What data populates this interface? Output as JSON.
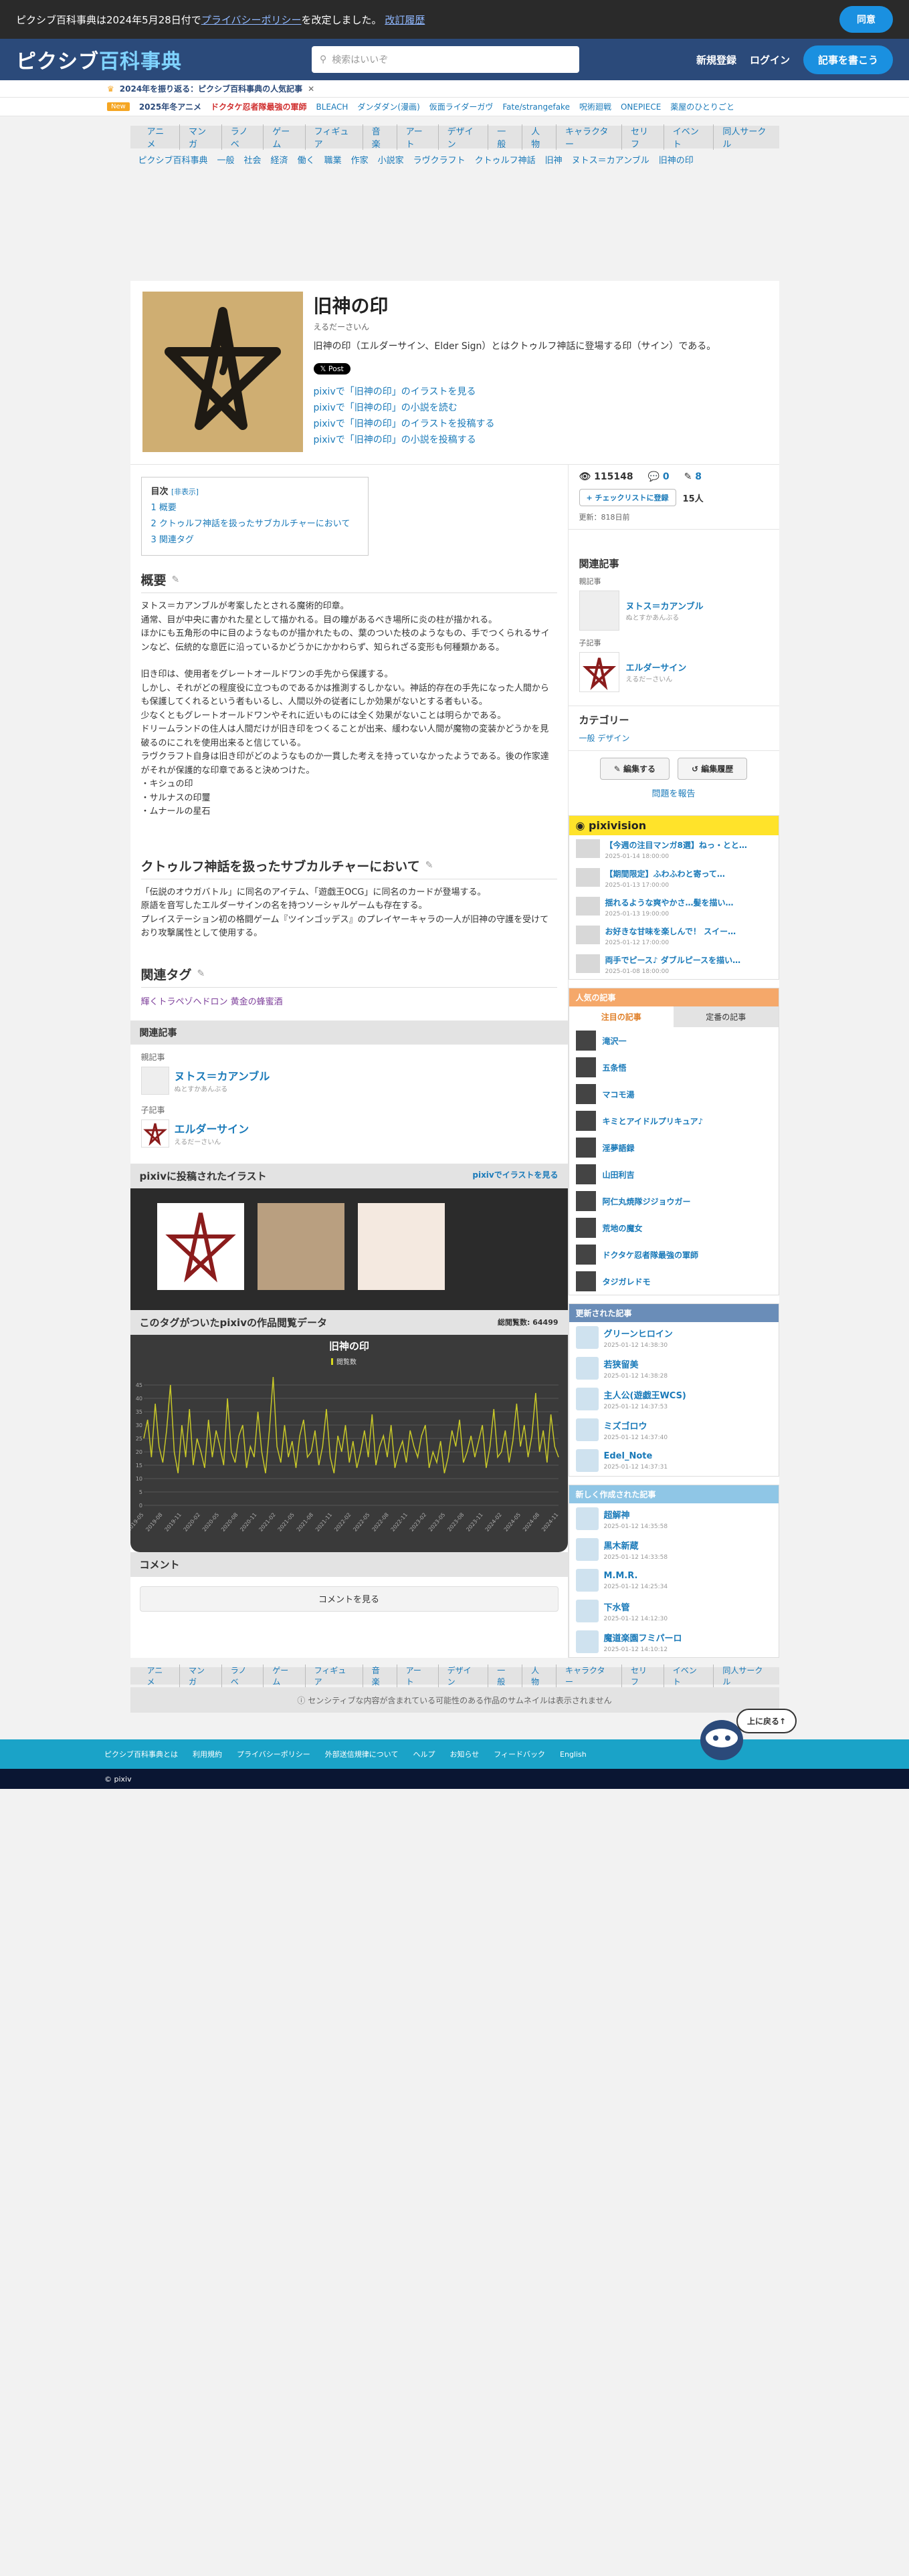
{
  "cookie": {
    "text1": "ピクシブ百科事典は2024年5月28日付で",
    "link": "プライバシーポリシー",
    "text2": "を改定しました。",
    "history": "改訂履歴",
    "agree": "同意"
  },
  "header": {
    "logo1": "ピクシブ",
    "logo2": "百科事典",
    "search_placeholder": "検索はいいぞ",
    "signup": "新規登録",
    "login": "ログイン",
    "edit": "記事を書こう"
  },
  "announce": "2024年を振り返る：ピクシブ百科事典の人気記事",
  "trend": {
    "badge": "New",
    "items": [
      "2025年冬アニメ",
      "ドクタケ忍者隊最強の軍師",
      "BLEACH",
      "ダンダダン(漫画)",
      "仮面ライダーガヴ",
      "Fate/strangefake",
      "呪術廻戦",
      "ONEPIECE",
      "薬屋のひとりごと"
    ]
  },
  "categories": [
    "アニメ",
    "マンガ",
    "ラノベ",
    "ゲーム",
    "フィギュア",
    "音楽",
    "アート",
    "デザイン",
    "一般",
    "人物",
    "キャラクター",
    "セリフ",
    "イベント",
    "同人サークル"
  ],
  "breadcrumb": [
    "ピクシブ百科事典",
    "一般",
    "社会",
    "経済",
    "働く",
    "職業",
    "作家",
    "小説家",
    "ラヴクラフト",
    "クトゥルフ神話",
    "旧神",
    "ヌトス＝カアンブル",
    "旧神の印"
  ],
  "article": {
    "title": "旧神の印",
    "reading": "えるだーさいん",
    "desc": "旧神の印（エルダーサイン、Elder Sign）とはクトゥルフ神話に登場する印（サイン）である。",
    "x_post": "Post",
    "links": [
      "pixivで「旧神の印」のイラストを見る",
      "pixivで「旧神の印」の小説を読む",
      "pixivで「旧神の印」のイラストを投稿する",
      "pixivで「旧神の印」の小説を投稿する"
    ]
  },
  "toc": {
    "title": "目次",
    "toggle": "[非表示]",
    "items": [
      "1 概要",
      "2 クトゥルフ神話を扱ったサブカルチャーにおいて",
      "3 関連タグ"
    ]
  },
  "overview": {
    "heading": "概要",
    "lines": [
      "ヌトス＝カアンブルが考案したとされる魔術的印章。",
      "通常、目が中央に書かれた星として描かれる。目の瞳があるべき場所に炎の柱が描かれる。",
      "ほかにも五角形の中に目のようなものが描かれたもの、葉のついた枝のようなもの、手でつくられるサインなど、伝統的な意匠に沿っているかどうかにかかわらず、知られざる変形も何種類かある。",
      "",
      "旧き印は、使用者をグレートオールドワンの手先から保護する。",
      "しかし、それがどの程度役に立つものであるかは推測するしかない。神話的存在の手先になった人間からも保護してくれるという者もいるし、人間以外の従者にしか効果がないとする者もいる。",
      "少なくともグレートオールドワンやそれに近いものには全く効果がないことは明らかである。",
      "ドリームランドの住人は人間だけが旧き印をつくることが出来、緩わない人間が魔物の変装かどうかを見破るのにこれを使用出来ると信じている。",
      "ラヴクラフト自身は旧き印がどのようなものか一貫した考えを持っていなかったようである。後の作家達がそれが保護的な印章であると決めつけた。",
      "・キシュの印",
      "・サルナスの印璽",
      "・ムナールの星石"
    ]
  },
  "subculture": {
    "heading": "クトゥルフ神話を扱ったサブカルチャーにおいて",
    "lines": [
      "「伝説のオウガバトル」に同名のアイテム、「遊戯王OCG」に同名のカードが登場する。",
      "原語を音写したエルダーサインの名を持つソーシャルゲームも存在する。",
      "プレイステーション初の格闘ゲーム『ツインゴッデス』のプレイヤーキャラの一人が旧神の守護を受けており攻撃属性として使用する。"
    ]
  },
  "tags": {
    "heading": "関連タグ",
    "items": [
      "輝くトラペゾヘドロン",
      "黄金の蜂蜜酒"
    ]
  },
  "related": {
    "heading": "関連記事",
    "parent_label": "親記事",
    "parent": "ヌトス＝カアンブル",
    "parent_read": "ぬとすかあんぶる",
    "child_label": "子記事",
    "child": "エルダーサイン",
    "child_read": "えるだーさいん"
  },
  "pixiv": {
    "heading": "pixivに投稿されたイラスト",
    "link": "pixivでイラストを見る"
  },
  "chart_header": {
    "heading": "このタグがついたpixivの作品閲覧データ",
    "total": "総閲覧数: 64499"
  },
  "chart_data": {
    "type": "line",
    "title": "旧神の印",
    "legend": "閲覧数",
    "yticks": [
      0,
      5,
      10,
      15,
      20,
      25,
      30,
      35,
      40,
      45
    ],
    "ylim": [
      0,
      50
    ],
    "values": [
      25,
      32,
      18,
      38,
      22,
      16,
      28,
      45,
      20,
      12,
      30,
      18,
      36,
      15,
      25,
      20,
      14,
      32,
      18,
      28,
      22,
      15,
      40,
      20,
      16,
      26,
      30,
      14,
      22,
      18,
      35,
      20,
      12,
      28,
      48,
      22,
      16,
      30,
      18,
      24,
      14,
      26,
      32,
      18,
      20,
      28,
      15,
      22,
      36,
      18,
      12,
      26,
      20,
      30,
      16,
      24,
      14,
      20,
      28,
      18,
      34,
      15,
      22,
      26,
      18,
      30,
      14,
      20,
      24,
      16,
      28,
      22,
      18,
      26,
      30,
      14,
      20,
      16,
      24,
      12,
      18,
      28,
      22,
      32,
      16,
      20,
      26,
      18,
      24,
      30,
      14,
      22,
      36,
      18,
      20,
      28,
      16,
      24,
      38,
      22,
      30,
      18,
      26,
      42,
      20,
      28,
      16,
      34,
      22,
      18
    ],
    "xlabels": [
      "2019-05",
      "2019-08",
      "2019-11",
      "2020-02",
      "2020-05",
      "2020-08",
      "2020-11",
      "2021-02",
      "2021-05",
      "2021-08",
      "2021-11",
      "2022-02",
      "2022-05",
      "2022-08",
      "2022-11",
      "2023-02",
      "2023-05",
      "2023-08",
      "2023-11",
      "2024-02",
      "2024-05",
      "2024-08",
      "2024-11"
    ]
  },
  "comment": {
    "heading": "コメント",
    "button": "コメントを見る"
  },
  "stats": {
    "views": "115148",
    "comments": "0",
    "edits": "8",
    "checklist": "チェックリストに登録",
    "check_count": "15人",
    "updated": "更新：818日前"
  },
  "side_related": {
    "heading": "関連記事",
    "parent_label": "親記事",
    "parent": "ヌトス＝カアンブル",
    "parent_read": "ぬとすかあんぶる",
    "child_label": "子記事",
    "child": "エルダーサイン",
    "child_read": "えるだーさいん"
  },
  "side_cat": {
    "heading": "カテゴリー",
    "items": [
      "一般",
      "デザイン"
    ]
  },
  "side_btns": {
    "edit": "編集する",
    "history": "編集履歴",
    "report": "問題を報告"
  },
  "pixivision": {
    "heading": "pixivision",
    "items": [
      {
        "t": "【今週の注目マンガ8選】ねっ・とと…",
        "d": "2025-01-14 18:00:00"
      },
      {
        "t": "【期間限定】ふわふわと寄って…",
        "d": "2025-01-13 17:00:00"
      },
      {
        "t": "揺れるような爽やかさ…髪を描い…",
        "d": "2025-01-13 19:00:00"
      },
      {
        "t": "お好きな甘味を楽しんで！ スイー…",
        "d": "2025-01-12 17:00:00"
      },
      {
        "t": "両手でピース♪ ダブルピースを描い…",
        "d": "2025-01-08 18:00:00"
      }
    ]
  },
  "popular": {
    "heading": "人気の記事",
    "tab1": "注目の記事",
    "tab2": "定番の記事",
    "items": [
      "滝沢一",
      "五条悟",
      "マコモ湯",
      "キミとアイドルプリキュア♪",
      "淫夢語録",
      "山田利吉",
      "阿仁丸焼隊ジジョウガー",
      "荒地の魔女",
      "ドクタケ忍者隊最強の軍師",
      "タジガレドモ"
    ]
  },
  "updated": {
    "heading": "更新された記事",
    "items": [
      {
        "t": "グリーンヒロイン",
        "d": "2025-01-12 14:38:30"
      },
      {
        "t": "若狭留美",
        "d": "2025-01-12 14:38:28"
      },
      {
        "t": "主人公(遊戯王WCS)",
        "d": "2025-01-12 14:37:53"
      },
      {
        "t": "ミズゴロウ",
        "d": "2025-01-12 14:37:40"
      },
      {
        "t": "Edel_Note",
        "d": "2025-01-12 14:37:31"
      }
    ]
  },
  "newarticles": {
    "heading": "新しく作成された記事",
    "items": [
      {
        "t": "超解神",
        "d": "2025-01-12 14:35:58"
      },
      {
        "t": "黒木新蔵",
        "d": "2025-01-12 14:33:58"
      },
      {
        "t": "M.M.R.",
        "d": "2025-01-12 14:25:34"
      },
      {
        "t": "下水管",
        "d": "2025-01-12 14:12:30"
      },
      {
        "t": "魔道楽園フミパーロ",
        "d": "2025-01-12 14:10:12"
      }
    ]
  },
  "notice": "センシティブな内容が含まれている可能性のある作品のサムネイルは表示されません",
  "footer": {
    "links": [
      "ピクシブ百科事典とは",
      "利用規約",
      "プライバシーポリシー",
      "外部送信規律について",
      "ヘルプ",
      "お知らせ",
      "フィードバック",
      "English"
    ],
    "copyright": "© pixiv",
    "back_top": "上に戻る↑"
  }
}
